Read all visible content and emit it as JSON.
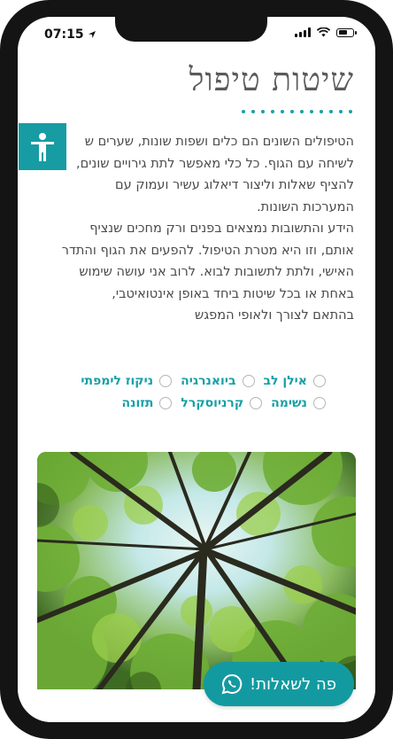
{
  "status_bar": {
    "time": "07:15"
  },
  "page": {
    "title": "שיטות טיפול",
    "accent_color": "#179ca3"
  },
  "body_lines": [
    "הטיפולים השונים הם כלים ושפות שונות, שערים ש",
    "לשיחה עם הגוף. כל כלי מאפשר לתת גירויים שונים,",
    "להציף שאלות וליצור דיאלוג עשיר ועמוק עם",
    "המערכות השונות.",
    "הידע והתשובות נמצאים בפנים ורק מחכים שנציף",
    "אותם, וזו היא מטרת הטיפול. להפעים את הגוף והתדר",
    "האישי, ולתת לתשובות לבוא. לרוב אני עושה שימוש",
    "באחת או בכל שיטות ביחד באופן אינטואיטבי,",
    "בהתאם לצורך ולאופי המפגש"
  ],
  "options_row1": [
    "אילן לב",
    "ביואנרגיה",
    "ניקוז לימפתי"
  ],
  "options_row2": [
    "נשימה",
    "קרניוסקרל",
    "תזונה"
  ],
  "whatsapp": {
    "label": "פה לשאלות!",
    "icon": "whatsapp-icon"
  },
  "accessibility": {
    "icon": "accessibility-person-icon"
  },
  "photo": {
    "subject": "forest-canopy-photo"
  }
}
